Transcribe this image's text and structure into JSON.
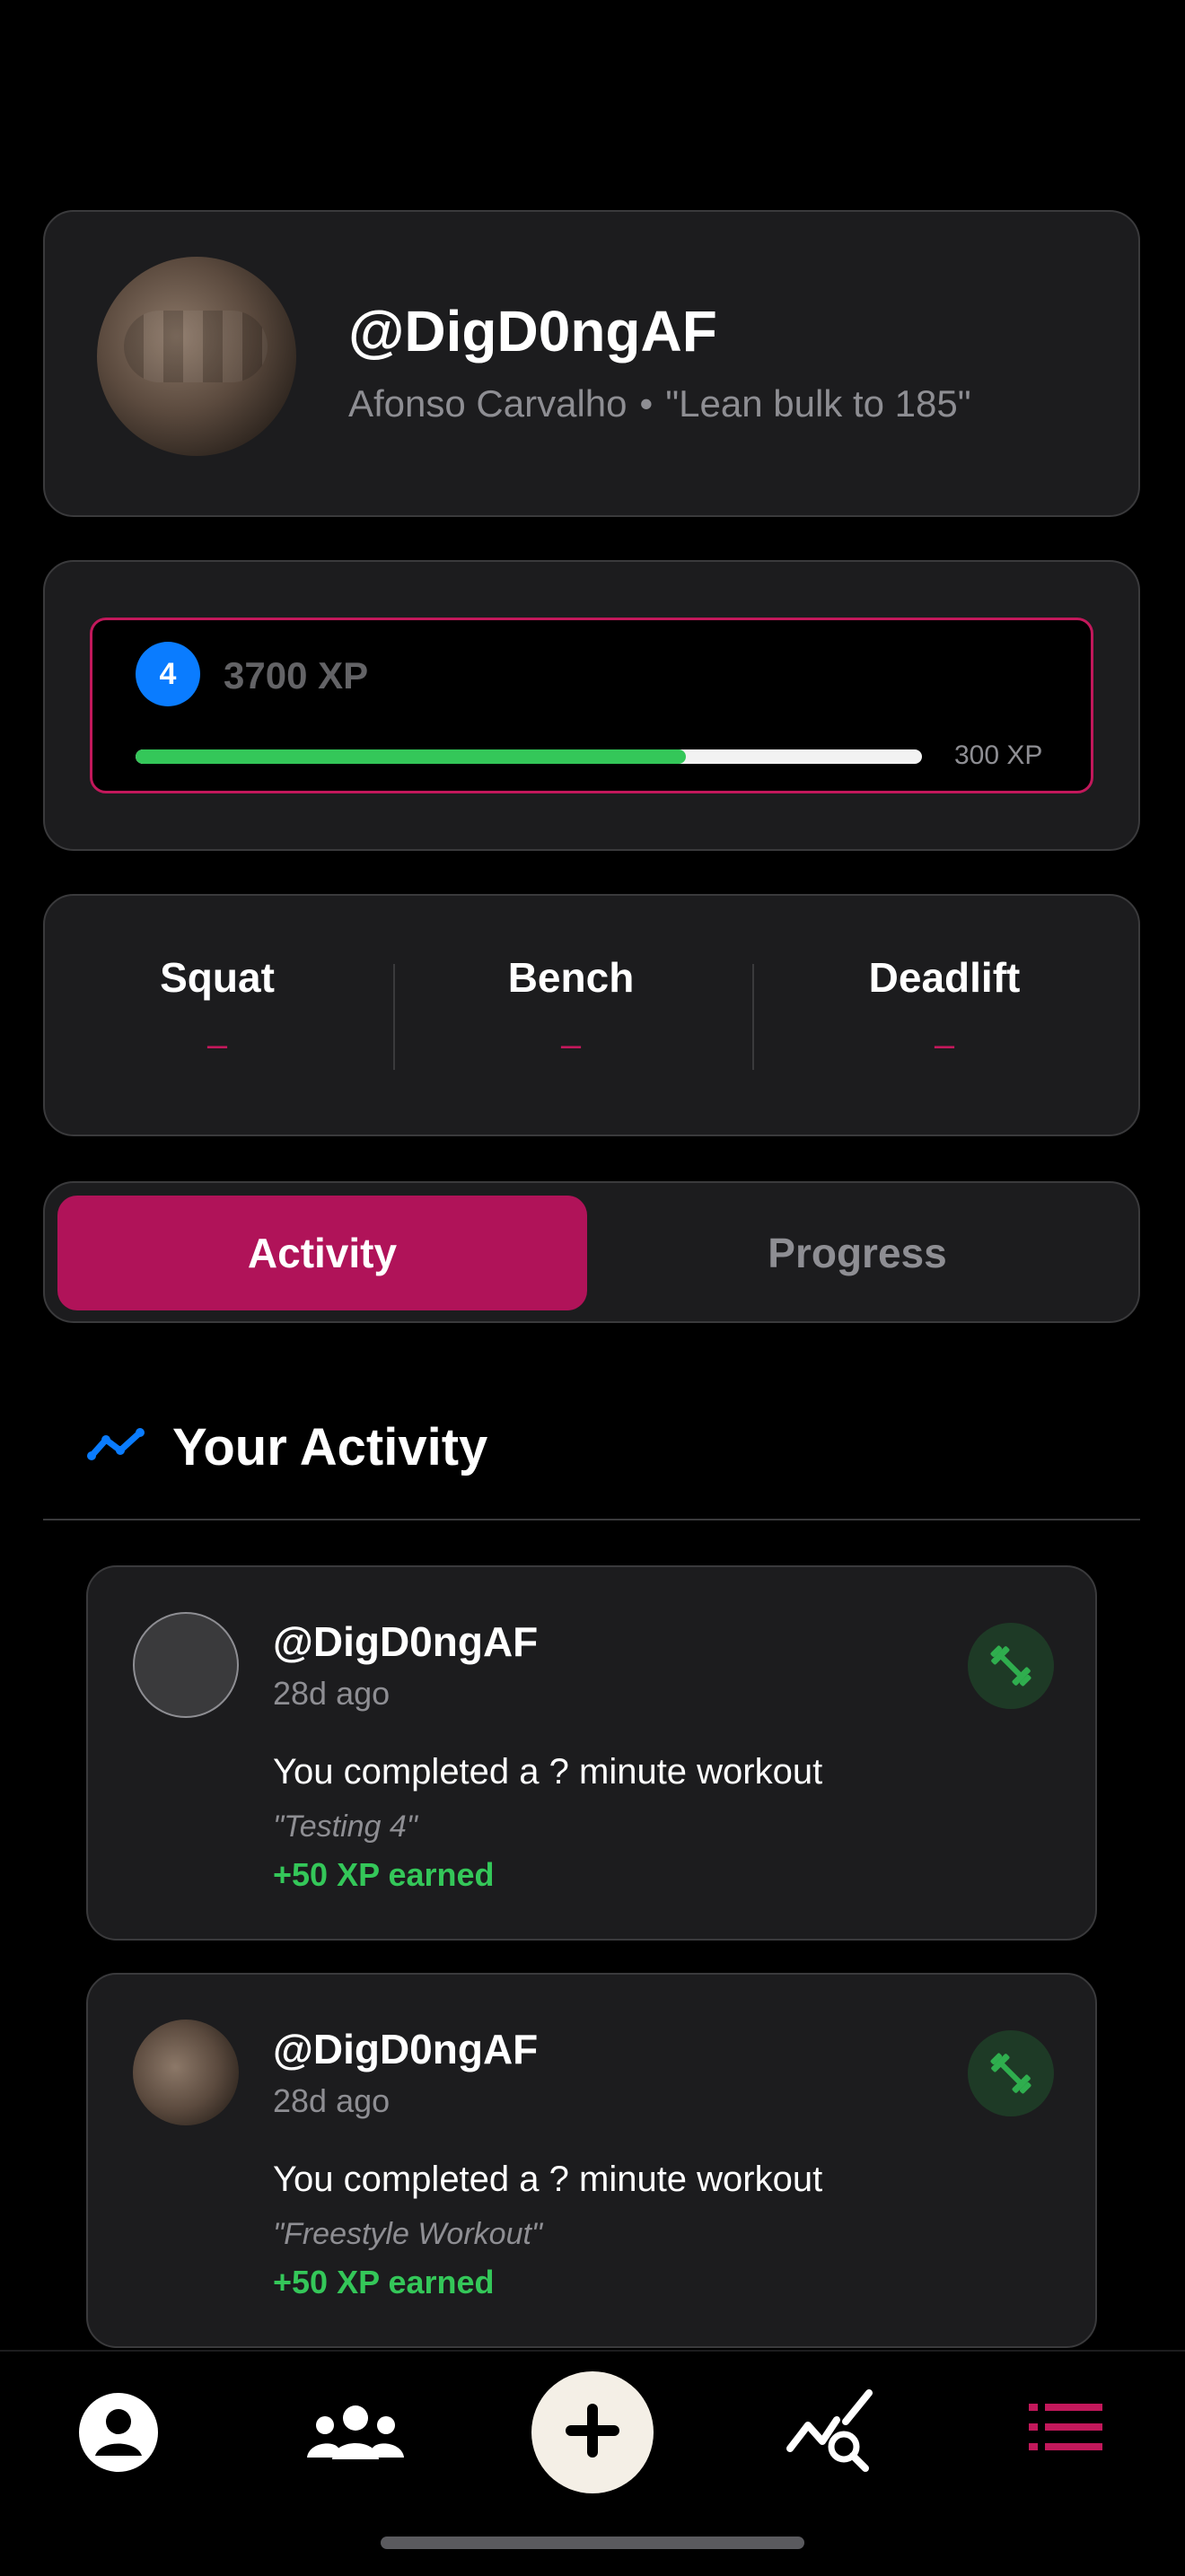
{
  "profile": {
    "handle": "@DigD0ngAF",
    "name": "Afonso Carvalho",
    "separator": "•",
    "goal": "\"Lean bulk to 185\""
  },
  "xp": {
    "level": "4",
    "total": "3700 XP",
    "remaining": "300 XP",
    "progress_fraction": 0.7
  },
  "lifts": [
    {
      "name": "Squat",
      "value": "–"
    },
    {
      "name": "Bench",
      "value": "–"
    },
    {
      "name": "Deadlift",
      "value": "–"
    }
  ],
  "tabs": {
    "activity": "Activity",
    "progress": "Progress"
  },
  "activity_section": {
    "title": "Your Activity"
  },
  "activities": [
    {
      "handle": "@DigD0ngAF",
      "time": "28d ago",
      "text": "You completed a ? minute workout",
      "quote": "\"Testing 4\"",
      "xp": "+50 XP earned",
      "icon": "dumbbell-icon"
    },
    {
      "handle": "@DigD0ngAF",
      "time": "28d ago",
      "text": "You completed a ? minute workout",
      "quote": "\"Freestyle Workout\"",
      "xp": "+50 XP earned",
      "icon": "dumbbell-icon"
    }
  ],
  "nav": {
    "items": [
      "profile-icon",
      "friends-icon",
      "add-icon",
      "stats-search-icon",
      "list-icon"
    ],
    "active": "list-icon"
  },
  "colors": {
    "accent": "#b01359",
    "accent_border": "#c2185b",
    "success": "#34c759",
    "level_blue": "#0a7cff",
    "card": "#1c1c1e"
  }
}
